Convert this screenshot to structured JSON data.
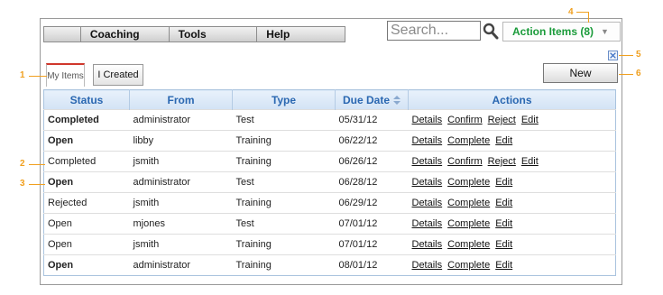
{
  "nav": {
    "items": [
      {
        "label": "Coaching",
        "width": 0
      },
      {
        "label": "Tools"
      },
      {
        "label": "Help"
      }
    ]
  },
  "search": {
    "placeholder": "Search..."
  },
  "action_items": {
    "label": "Action Items (8)"
  },
  "tabs": [
    {
      "label": "My Items",
      "active": true
    },
    {
      "label": "I Created",
      "active": false
    }
  ],
  "new_button": {
    "label": "New"
  },
  "table": {
    "headers": [
      "Status",
      "From",
      "Type",
      "Due Date",
      "Actions"
    ],
    "rows": [
      {
        "status": "Completed",
        "from": "administrator",
        "type": "Test",
        "due": "05/31/12",
        "actions": [
          "Details",
          "Confirm",
          "Reject",
          "Edit"
        ],
        "bold": true
      },
      {
        "status": "Open",
        "from": "libby",
        "type": "Training",
        "due": "06/22/12",
        "actions": [
          "Details",
          "Complete",
          "Edit"
        ],
        "bold": true
      },
      {
        "status": "Completed",
        "from": "jsmith",
        "type": "Training",
        "due": "06/26/12",
        "actions": [
          "Details",
          "Confirm",
          "Reject",
          "Edit"
        ],
        "bold": false
      },
      {
        "status": "Open",
        "from": "administrator",
        "type": "Test",
        "due": "06/28/12",
        "actions": [
          "Details",
          "Complete",
          "Edit"
        ],
        "bold": true
      },
      {
        "status": "Rejected",
        "from": "jsmith",
        "type": "Training",
        "due": "06/29/12",
        "actions": [
          "Details",
          "Complete",
          "Edit"
        ],
        "bold": false
      },
      {
        "status": "Open",
        "from": "mjones",
        "type": "Test",
        "due": "07/01/12",
        "actions": [
          "Details",
          "Complete",
          "Edit"
        ],
        "bold": false
      },
      {
        "status": "Open",
        "from": "jsmith",
        "type": "Training",
        "due": "07/01/12",
        "actions": [
          "Details",
          "Complete",
          "Edit"
        ],
        "bold": false
      },
      {
        "status": "Open",
        "from": "administrator",
        "type": "Training",
        "due": "08/01/12",
        "actions": [
          "Details",
          "Complete",
          "Edit"
        ],
        "bold": true
      }
    ]
  },
  "callouts": [
    "1",
    "2",
    "3",
    "4",
    "5",
    "6"
  ],
  "colors": {
    "accent": "#2a67b1",
    "action_items": "#1a9b3a",
    "callout": "#f0a020",
    "active_tab": "#d0372c"
  }
}
